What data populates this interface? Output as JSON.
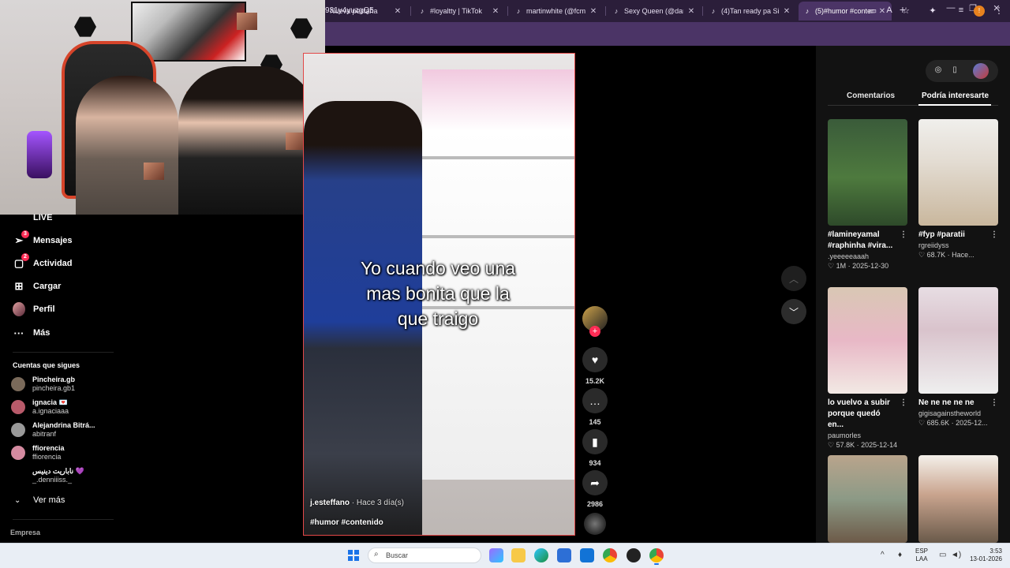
{
  "browser": {
    "tabs": [
      {
        "label": "Nueva pestaña",
        "icon": "chrome-newtab-icon"
      },
      {
        "label": "#loyaltty | TikTok",
        "icon": "tiktok-icon"
      },
      {
        "label": "martinwhite (@fcmar",
        "icon": "tiktok-icon"
      },
      {
        "label": "Sexy Queen (@daniel",
        "icon": "tiktok-icon"
      },
      {
        "label": "(4)Tan ready pa Sinto",
        "icon": "tiktok-icon"
      },
      {
        "label": "(5)#humor #contenid",
        "icon": "tiktok-icon",
        "active": true
      }
    ],
    "url": "931y4yuzgQ5",
    "profile_initial": "!"
  },
  "sidebar": {
    "items": [
      {
        "label": "LIVE",
        "icon": "live-icon"
      },
      {
        "label": "Mensajes",
        "icon": "messages-icon",
        "badge": "3"
      },
      {
        "label": "Actividad",
        "icon": "activity-icon",
        "badge": "2"
      },
      {
        "label": "Cargar",
        "icon": "upload-icon"
      },
      {
        "label": "Perfil",
        "icon": "profile-avatar"
      },
      {
        "label": "Más",
        "icon": "more-icon"
      }
    ],
    "following_title": "Cuentas que sigues",
    "following": [
      {
        "name": "Pincheira.gb",
        "handle": "pincheira.gb1",
        "color": "#7a6a5a"
      },
      {
        "name": "ignacia 💌",
        "handle": "a.ignaciaaa",
        "color": "#b85a6a"
      },
      {
        "name": "Alejandrina Bitrá...",
        "handle": "abitranf",
        "color": "#999999"
      },
      {
        "name": "ffiorencia",
        "handle": "ffiorencia",
        "color": "#d48aa0"
      },
      {
        "name": "ناباريت دينيس 💜",
        "handle": "_.denniiiss._",
        "color": "#000000"
      }
    ],
    "see_more": "Ver más",
    "footer": "Empresa"
  },
  "video": {
    "caption_lines": [
      "Yo cuando veo una",
      "mas bonita que la",
      "que traigo"
    ],
    "author": "j.esteffano",
    "posted": "· Hace 3 día(s)",
    "tags": "#humor #contenido"
  },
  "actions": {
    "likes": "15.2K",
    "comments": "145",
    "saves": "934",
    "shares": "2986"
  },
  "right_panel": {
    "tab_comments": "Comentarios",
    "tab_suggested": "Podría interesarte",
    "cards": [
      {
        "title": "#lamineyamal #raphinha #vira...",
        "user": ".yeeeeeaaah",
        "stats": "♡ 1M · 2025-12-30"
      },
      {
        "title": "#fyp #paratii",
        "user": "rgreiidyss",
        "stats": "♡ 68.7K · Hace..."
      },
      {
        "title": "lo vuelvo a subir porque quedó en...",
        "user": "paumorles",
        "stats": "♡ 57.8K · 2025-12-14"
      },
      {
        "title": "Ne ne ne ne ne",
        "user": "gigisagainstheworld",
        "stats": "♡ 685.6K · 2025-12..."
      },
      {
        "title": "",
        "user": "",
        "stats": ""
      },
      {
        "title": "",
        "user": "",
        "stats": ""
      }
    ]
  },
  "taskbar": {
    "search_label": "Buscar",
    "lang_line1": "ESP",
    "lang_line2": "LAA",
    "time": "3:53",
    "date": "13-01-2026"
  },
  "colors": {
    "accent": "#fe2c55",
    "browser_frame": "#4b3466",
    "video_border": "#e24848"
  }
}
